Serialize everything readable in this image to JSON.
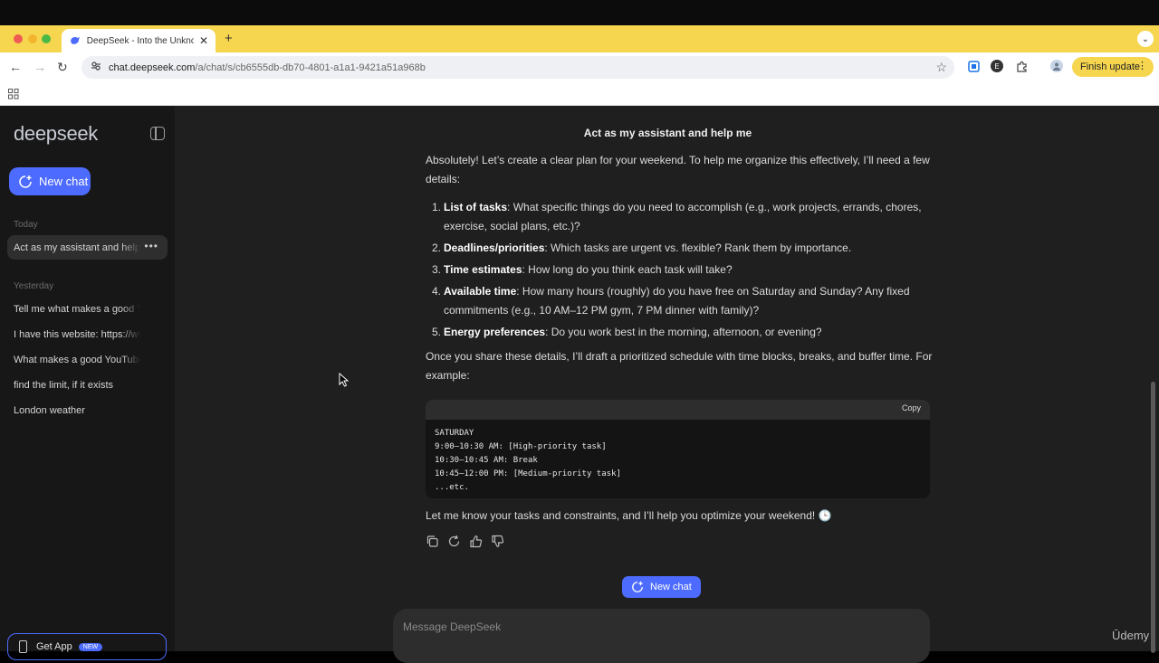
{
  "browser": {
    "tab_title": "DeepSeek - Into the Unknown",
    "url_host": "chat.deepseek.com",
    "url_path": "/a/chat/s/cb6555db-db70-4801-a1a1-9421a51a968b",
    "finish_update_label": "Finish update",
    "profile_initial": "E"
  },
  "sidebar": {
    "logo": "deepseek",
    "new_chat_label": "New chat",
    "today_label": "Today",
    "today_items": [
      "Act as my assistant and help me"
    ],
    "yesterday_label": "Yesterday",
    "yesterday_items": [
      "Tell me what makes a good YouTube video",
      "I have this website: https://www",
      "What makes a good YouTube video",
      "find the limit, if it exists",
      "London weather"
    ],
    "get_app_label": "Get App",
    "new_badge": "NEW"
  },
  "chat": {
    "title": "Act as my assistant and help me",
    "intro": "Absolutely! Let’s create a clear plan for your weekend. To help me organize this effectively, I’ll need a few details:",
    "items": [
      {
        "num": "1.",
        "bold": "List of tasks",
        "text": ": What specific things do you need to accomplish (e.g., work projects, errands, chores, exercise, social plans, etc.)?"
      },
      {
        "num": "2.",
        "bold": "Deadlines/priorities",
        "text": ": Which tasks are urgent vs. flexible? Rank them by importance."
      },
      {
        "num": "3.",
        "bold": "Time estimates",
        "text": ": How long do you think each task will take?"
      },
      {
        "num": "4.",
        "bold": "Available time",
        "text": ": How many hours (roughly) do you have free on Saturday and Sunday? Any fixed commitments (e.g., 10 AM–12 PM gym, 7 PM dinner with family)?"
      },
      {
        "num": "5.",
        "bold": "Energy preferences",
        "text": ": Do you work best in the morning, afternoon, or evening?"
      }
    ],
    "followup": "Once you share these details, I’ll draft a prioritized schedule with time blocks, breaks, and buffer time. For example:",
    "copy_label": "Copy",
    "code": "SATURDAY\n9:00–10:30 AM: [High-priority task]\n10:30–10:45 AM: Break\n10:45–12:00 PM: [Medium-priority task]\n...etc.",
    "closing": "Let me know your tasks and constraints, and I’ll help you optimize your weekend! 🕒",
    "new_chat_label": "New chat",
    "message_placeholder": "Message DeepSeek"
  },
  "watermark": "Ūdemy",
  "colors": {
    "accent": "#4d6bfe",
    "sidebar_bg": "#171717",
    "main_bg": "#1f1f1f",
    "browser_frame": "#f6d64f"
  }
}
